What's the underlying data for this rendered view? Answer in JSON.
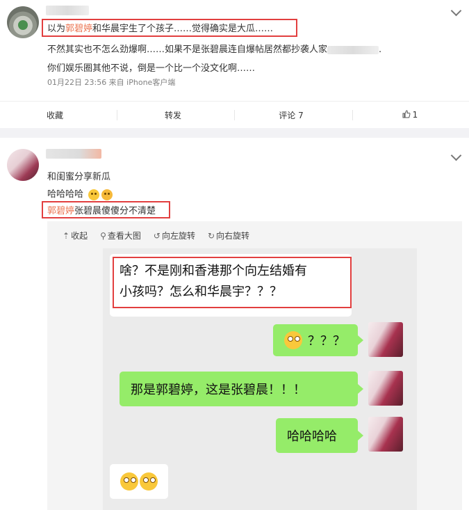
{
  "post1": {
    "line1_pre": "以为",
    "line1_name": "郭碧婷",
    "line1_post": "和华晨宇生了个孩子……觉得确实是大瓜……",
    "line2": "不然其实也不怎么劲爆啊……如果不是张碧晨连自爆帖居然都抄袭人家",
    "line2_end": ".",
    "line3": "你们娱乐圈其他不说，倒是一个比一个没文化啊……",
    "meta": "01月22日 23:56  来自 iPhone客户端"
  },
  "actions": {
    "favorite": "收藏",
    "repost": "转发",
    "comment": "评论 7",
    "like_icon": "thumb-up-icon",
    "like_count": "1"
  },
  "post2": {
    "line1": "和闺蜜分享新瓜",
    "line2": "哈哈哈哈",
    "line3_name": "郭碧婷",
    "line3_rest": "张碧晨傻傻分不清楚"
  },
  "toolbar": {
    "collapse": "收起",
    "view_large": "查看大图",
    "rotate_left": "向左旋转",
    "rotate_right": "向右旋转"
  },
  "chat": {
    "msg1_line1": "啥？不是刚和香港那个向左结婚有",
    "msg1_line2": "小孩吗？怎么和华晨宇？？？",
    "msg2": "？？？",
    "msg3": "那是郭碧婷，这是张碧晨！！！",
    "msg4": "哈哈哈哈"
  },
  "colors": {
    "highlight": "#eb7350",
    "red_box": "#e23f3f",
    "chat_green": "#95ec69"
  }
}
